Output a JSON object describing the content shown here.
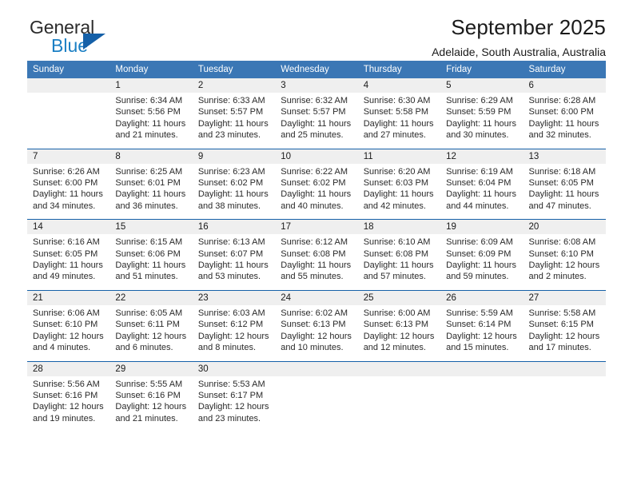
{
  "brand": {
    "name_part1": "General",
    "name_part2": "Blue",
    "accent_color": "#1b7fc4",
    "triangle_color": "#1560a8"
  },
  "header": {
    "title": "September 2025",
    "subtitle": "Adelaide, South Australia, Australia"
  },
  "theme": {
    "header_bg": "#3b77b5",
    "header_text": "#ffffff",
    "daynum_bg": "#efefef",
    "week_rule": "#1560a8"
  },
  "calendar": {
    "weekday_headers": [
      "Sunday",
      "Monday",
      "Tuesday",
      "Wednesday",
      "Thursday",
      "Friday",
      "Saturday"
    ],
    "weeks": [
      {
        "days": [
          {
            "num": "",
            "sunrise": "",
            "sunset": "",
            "daylight_1": "",
            "daylight_2": ""
          },
          {
            "num": "1",
            "sunrise": "Sunrise: 6:34 AM",
            "sunset": "Sunset: 5:56 PM",
            "daylight_1": "Daylight: 11 hours",
            "daylight_2": "and 21 minutes."
          },
          {
            "num": "2",
            "sunrise": "Sunrise: 6:33 AM",
            "sunset": "Sunset: 5:57 PM",
            "daylight_1": "Daylight: 11 hours",
            "daylight_2": "and 23 minutes."
          },
          {
            "num": "3",
            "sunrise": "Sunrise: 6:32 AM",
            "sunset": "Sunset: 5:57 PM",
            "daylight_1": "Daylight: 11 hours",
            "daylight_2": "and 25 minutes."
          },
          {
            "num": "4",
            "sunrise": "Sunrise: 6:30 AM",
            "sunset": "Sunset: 5:58 PM",
            "daylight_1": "Daylight: 11 hours",
            "daylight_2": "and 27 minutes."
          },
          {
            "num": "5",
            "sunrise": "Sunrise: 6:29 AM",
            "sunset": "Sunset: 5:59 PM",
            "daylight_1": "Daylight: 11 hours",
            "daylight_2": "and 30 minutes."
          },
          {
            "num": "6",
            "sunrise": "Sunrise: 6:28 AM",
            "sunset": "Sunset: 6:00 PM",
            "daylight_1": "Daylight: 11 hours",
            "daylight_2": "and 32 minutes."
          }
        ]
      },
      {
        "days": [
          {
            "num": "7",
            "sunrise": "Sunrise: 6:26 AM",
            "sunset": "Sunset: 6:00 PM",
            "daylight_1": "Daylight: 11 hours",
            "daylight_2": "and 34 minutes."
          },
          {
            "num": "8",
            "sunrise": "Sunrise: 6:25 AM",
            "sunset": "Sunset: 6:01 PM",
            "daylight_1": "Daylight: 11 hours",
            "daylight_2": "and 36 minutes."
          },
          {
            "num": "9",
            "sunrise": "Sunrise: 6:23 AM",
            "sunset": "Sunset: 6:02 PM",
            "daylight_1": "Daylight: 11 hours",
            "daylight_2": "and 38 minutes."
          },
          {
            "num": "10",
            "sunrise": "Sunrise: 6:22 AM",
            "sunset": "Sunset: 6:02 PM",
            "daylight_1": "Daylight: 11 hours",
            "daylight_2": "and 40 minutes."
          },
          {
            "num": "11",
            "sunrise": "Sunrise: 6:20 AM",
            "sunset": "Sunset: 6:03 PM",
            "daylight_1": "Daylight: 11 hours",
            "daylight_2": "and 42 minutes."
          },
          {
            "num": "12",
            "sunrise": "Sunrise: 6:19 AM",
            "sunset": "Sunset: 6:04 PM",
            "daylight_1": "Daylight: 11 hours",
            "daylight_2": "and 44 minutes."
          },
          {
            "num": "13",
            "sunrise": "Sunrise: 6:18 AM",
            "sunset": "Sunset: 6:05 PM",
            "daylight_1": "Daylight: 11 hours",
            "daylight_2": "and 47 minutes."
          }
        ]
      },
      {
        "days": [
          {
            "num": "14",
            "sunrise": "Sunrise: 6:16 AM",
            "sunset": "Sunset: 6:05 PM",
            "daylight_1": "Daylight: 11 hours",
            "daylight_2": "and 49 minutes."
          },
          {
            "num": "15",
            "sunrise": "Sunrise: 6:15 AM",
            "sunset": "Sunset: 6:06 PM",
            "daylight_1": "Daylight: 11 hours",
            "daylight_2": "and 51 minutes."
          },
          {
            "num": "16",
            "sunrise": "Sunrise: 6:13 AM",
            "sunset": "Sunset: 6:07 PM",
            "daylight_1": "Daylight: 11 hours",
            "daylight_2": "and 53 minutes."
          },
          {
            "num": "17",
            "sunrise": "Sunrise: 6:12 AM",
            "sunset": "Sunset: 6:08 PM",
            "daylight_1": "Daylight: 11 hours",
            "daylight_2": "and 55 minutes."
          },
          {
            "num": "18",
            "sunrise": "Sunrise: 6:10 AM",
            "sunset": "Sunset: 6:08 PM",
            "daylight_1": "Daylight: 11 hours",
            "daylight_2": "and 57 minutes."
          },
          {
            "num": "19",
            "sunrise": "Sunrise: 6:09 AM",
            "sunset": "Sunset: 6:09 PM",
            "daylight_1": "Daylight: 11 hours",
            "daylight_2": "and 59 minutes."
          },
          {
            "num": "20",
            "sunrise": "Sunrise: 6:08 AM",
            "sunset": "Sunset: 6:10 PM",
            "daylight_1": "Daylight: 12 hours",
            "daylight_2": "and 2 minutes."
          }
        ]
      },
      {
        "days": [
          {
            "num": "21",
            "sunrise": "Sunrise: 6:06 AM",
            "sunset": "Sunset: 6:10 PM",
            "daylight_1": "Daylight: 12 hours",
            "daylight_2": "and 4 minutes."
          },
          {
            "num": "22",
            "sunrise": "Sunrise: 6:05 AM",
            "sunset": "Sunset: 6:11 PM",
            "daylight_1": "Daylight: 12 hours",
            "daylight_2": "and 6 minutes."
          },
          {
            "num": "23",
            "sunrise": "Sunrise: 6:03 AM",
            "sunset": "Sunset: 6:12 PM",
            "daylight_1": "Daylight: 12 hours",
            "daylight_2": "and 8 minutes."
          },
          {
            "num": "24",
            "sunrise": "Sunrise: 6:02 AM",
            "sunset": "Sunset: 6:13 PM",
            "daylight_1": "Daylight: 12 hours",
            "daylight_2": "and 10 minutes."
          },
          {
            "num": "25",
            "sunrise": "Sunrise: 6:00 AM",
            "sunset": "Sunset: 6:13 PM",
            "daylight_1": "Daylight: 12 hours",
            "daylight_2": "and 12 minutes."
          },
          {
            "num": "26",
            "sunrise": "Sunrise: 5:59 AM",
            "sunset": "Sunset: 6:14 PM",
            "daylight_1": "Daylight: 12 hours",
            "daylight_2": "and 15 minutes."
          },
          {
            "num": "27",
            "sunrise": "Sunrise: 5:58 AM",
            "sunset": "Sunset: 6:15 PM",
            "daylight_1": "Daylight: 12 hours",
            "daylight_2": "and 17 minutes."
          }
        ]
      },
      {
        "days": [
          {
            "num": "28",
            "sunrise": "Sunrise: 5:56 AM",
            "sunset": "Sunset: 6:16 PM",
            "daylight_1": "Daylight: 12 hours",
            "daylight_2": "and 19 minutes."
          },
          {
            "num": "29",
            "sunrise": "Sunrise: 5:55 AM",
            "sunset": "Sunset: 6:16 PM",
            "daylight_1": "Daylight: 12 hours",
            "daylight_2": "and 21 minutes."
          },
          {
            "num": "30",
            "sunrise": "Sunrise: 5:53 AM",
            "sunset": "Sunset: 6:17 PM",
            "daylight_1": "Daylight: 12 hours",
            "daylight_2": "and 23 minutes."
          },
          {
            "num": "",
            "sunrise": "",
            "sunset": "",
            "daylight_1": "",
            "daylight_2": ""
          },
          {
            "num": "",
            "sunrise": "",
            "sunset": "",
            "daylight_1": "",
            "daylight_2": ""
          },
          {
            "num": "",
            "sunrise": "",
            "sunset": "",
            "daylight_1": "",
            "daylight_2": ""
          },
          {
            "num": "",
            "sunrise": "",
            "sunset": "",
            "daylight_1": "",
            "daylight_2": ""
          }
        ]
      }
    ]
  }
}
